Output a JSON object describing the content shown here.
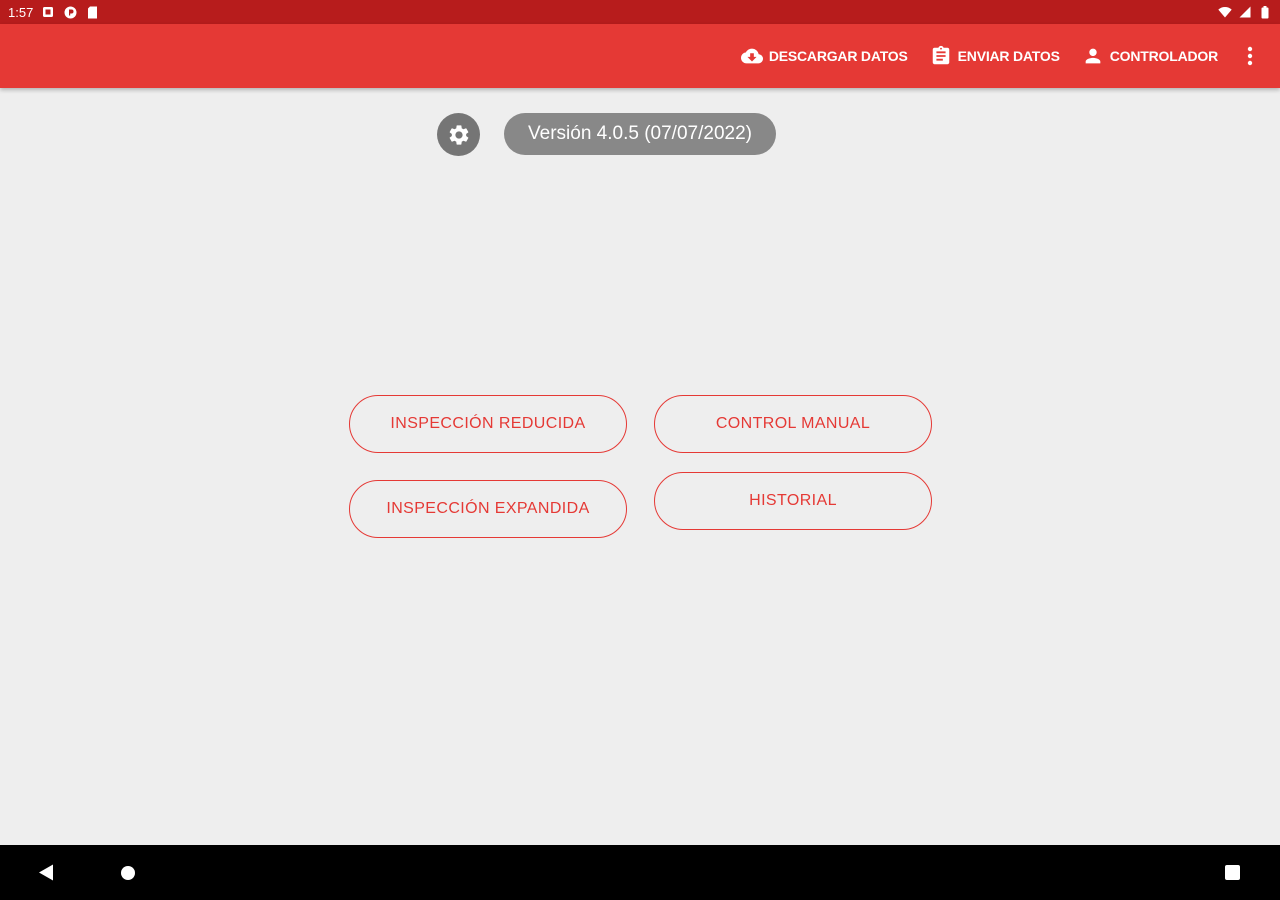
{
  "status_bar": {
    "time": "1:57",
    "left_icons": [
      "notification-icon",
      "app-badge-icon",
      "sd-card-icon"
    ],
    "right_icons": [
      "wifi-icon",
      "signal-icon",
      "battery-icon"
    ]
  },
  "app_bar": {
    "actions": [
      {
        "label": "DESCARGAR DATOS",
        "icon": "cloud-download-icon"
      },
      {
        "label": "ENVIAR DATOS",
        "icon": "clipboard-icon"
      },
      {
        "label": "CONTROLADOR",
        "icon": "person-icon"
      }
    ],
    "overflow_icon": "more-vert-icon"
  },
  "version": {
    "text": "Versión 4.0.5 (07/07/2022)",
    "settings_icon": "gear-icon"
  },
  "menu": {
    "inspeccion_reducida": "INSPECCIÓN REDUCIDA",
    "control_manual": "CONTROL MANUAL",
    "inspeccion_expandida": "INSPECCIÓN EXPANDIDA",
    "historial": "HISTORIAL"
  },
  "colors": {
    "status_bar": "#b71c1c",
    "app_bar": "#e53935",
    "accent": "#e53935",
    "background": "#eeeeee"
  }
}
